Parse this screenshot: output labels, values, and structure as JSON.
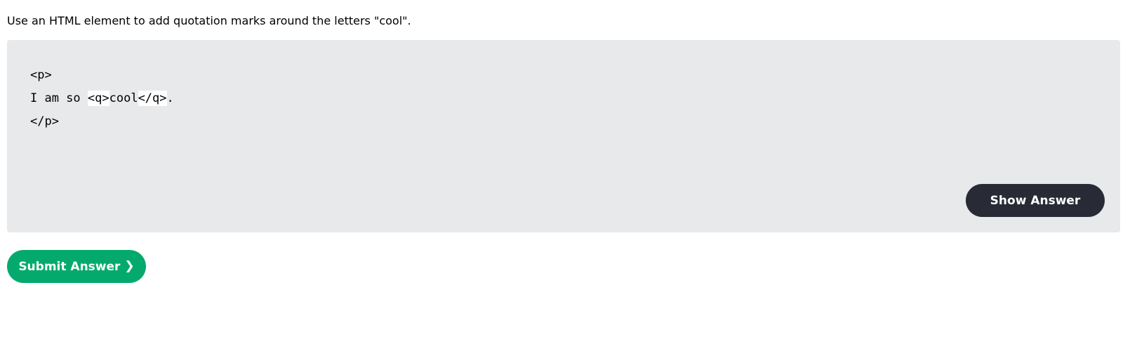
{
  "instruction": "Use an HTML element to add quotation marks around the letters \"cool\".",
  "code": {
    "line1": "<p>",
    "line2_prefix": "I am so ",
    "field1_value": "<q>",
    "line2_middle": "cool",
    "field2_value": "</q>",
    "line2_suffix": ".",
    "line3": "</p>"
  },
  "buttons": {
    "show_answer": "Show Answer",
    "submit": "Submit Answer",
    "submit_icon": "❯"
  },
  "colors": {
    "exercise_background": "#e7e9eb",
    "show_answer_background": "#282a35",
    "submit_background": "#04aa6d"
  }
}
